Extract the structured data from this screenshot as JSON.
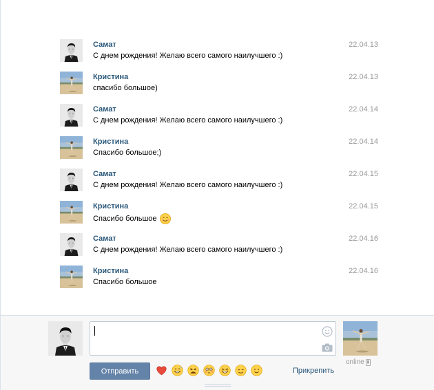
{
  "messages": [
    {
      "author": "Самат",
      "date": "22.04.13",
      "text": "С днем рождения! Желаю всего самого наилучшего :)",
      "who": "samat",
      "smile": false
    },
    {
      "author": "Кристина",
      "date": "22.04.13",
      "text": "спасибо большое)",
      "who": "kristina",
      "smile": false
    },
    {
      "author": "Самат",
      "date": "22.04.14",
      "text": "С днем рождения! Желаю всего самого наилучшего :)",
      "who": "samat",
      "smile": false
    },
    {
      "author": "Кристина",
      "date": "22.04.14",
      "text": "Спасибо большое;)",
      "who": "kristina",
      "smile": false
    },
    {
      "author": "Самат",
      "date": "22.04.15",
      "text": "С днем рождения! Желаю всего самого наилучшего :)",
      "who": "samat",
      "smile": false
    },
    {
      "author": "Кристина",
      "date": "22.04.15",
      "text": "Спасибо большое",
      "who": "kristina",
      "smile": true
    },
    {
      "author": "Самат",
      "date": "22.04.16",
      "text": "С днем рождения! Желаю всего самого наилучшего :)",
      "who": "samat",
      "smile": false
    },
    {
      "author": "Кристина",
      "date": "22.04.16",
      "text": "Спасибо большое",
      "who": "kristina",
      "smile": false
    }
  ],
  "composer": {
    "input_value": "",
    "send_label": "Отправить",
    "attach_label": "Прикрепить",
    "online_label": "online",
    "quick_smiles": [
      "heart-smile",
      "sweat-grin-smile",
      "tired-smile",
      "flushed-smile",
      "laughing-smile",
      "relieved-smile",
      "slight-smile"
    ]
  },
  "colors": {
    "link": "#2b587a",
    "date": "#999999",
    "send_button": "#6383a8",
    "composer_bg": "#f7f7f7"
  }
}
